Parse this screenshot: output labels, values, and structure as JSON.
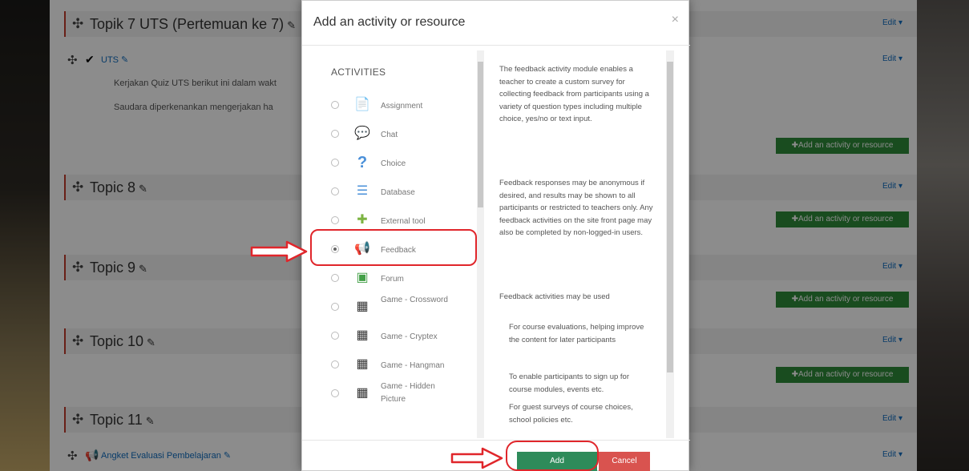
{
  "course": {
    "sections": [
      {
        "title": "Topik 7 UTS (Pertemuan ke 7)",
        "edit": "Edit ▾"
      },
      {
        "title": "Topic 8",
        "edit": "Edit ▾"
      },
      {
        "title": "Topic 9",
        "edit": "Edit ▾"
      },
      {
        "title": "Topic 10",
        "edit": "Edit ▾"
      },
      {
        "title": "Topic 11",
        "edit": "Edit ▾"
      }
    ],
    "uts_activity": {
      "name": "UTS",
      "edit": "Edit ▾"
    },
    "uts_desc1": "Kerjakan Quiz UTS berikut ini dalam wakt",
    "uts_desc2": "Saudara diperkenankan mengerjakan ha",
    "angket_activity": {
      "name": "Angket Evaluasi Pembelajaran",
      "edit": "Edit ▾"
    },
    "add_activity_label": "Add an activity or resource"
  },
  "modal": {
    "title": "Add an activity or resource",
    "close": "×",
    "category": "ACTIVITIES",
    "modules": [
      {
        "name": "Assignment",
        "icon": "assignment-icon",
        "selected": false
      },
      {
        "name": "Chat",
        "icon": "chat-icon",
        "selected": false
      },
      {
        "name": "Choice",
        "icon": "choice-icon",
        "selected": false
      },
      {
        "name": "Database",
        "icon": "database-icon",
        "selected": false
      },
      {
        "name": "External tool",
        "icon": "external-tool-icon",
        "selected": false
      },
      {
        "name": "Feedback",
        "icon": "feedback-icon",
        "selected": true
      },
      {
        "name": "Forum",
        "icon": "forum-icon",
        "selected": false
      },
      {
        "name": "Game - Crossword",
        "icon": "game-icon",
        "selected": false
      },
      {
        "name": "Game - Cryptex",
        "icon": "game-icon",
        "selected": false
      },
      {
        "name": "Game - Hangman",
        "icon": "game-icon",
        "selected": false
      },
      {
        "name": "Game - Hidden Picture",
        "icon": "game-icon",
        "selected": false
      }
    ],
    "help": {
      "p1": "The feedback activity module enables a teacher to create a custom survey for collecting feedback from participants using a variety of question types including multiple choice, yes/no or text input.",
      "p2": "Feedback responses may be anonymous if desired, and results may be shown to all participants or restricted to teachers only. Any feedback activities on the site front page may also be completed by non-logged-in users.",
      "p3": "Feedback activities may be used",
      "uses": [
        "For course evaluations, helping improve the content for later participants",
        "To enable participants to sign up for course modules, events etc.",
        "For guest surveys of course choices, school policies etc."
      ]
    },
    "add_button": "Add",
    "cancel_button": "Cancel"
  },
  "colors": {
    "add_green": "#2e8b5a",
    "cancel_red": "#d9534f",
    "highlight_red": "#e0262b",
    "link_blue": "#0f6cbf"
  }
}
